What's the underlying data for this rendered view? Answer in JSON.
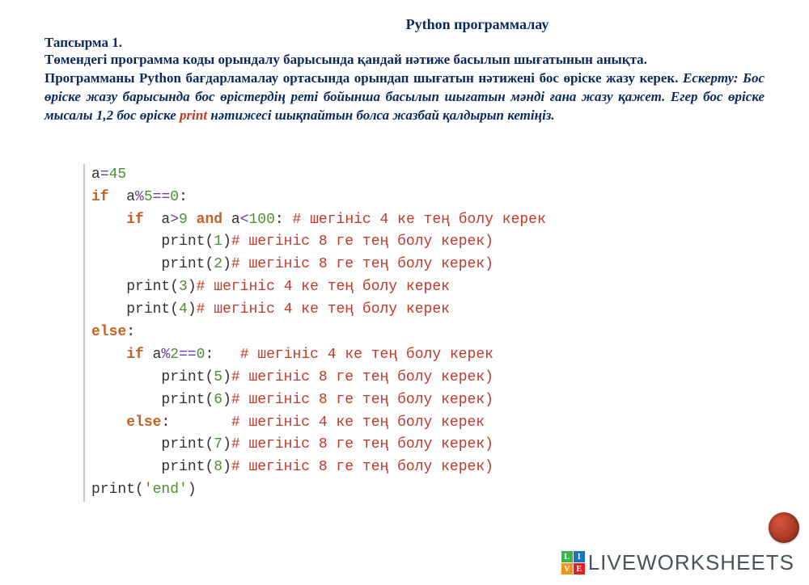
{
  "title": "Python программалау",
  "task_label": "Тапсырма 1.",
  "para1": "Төмендегі программа коды орындалу барысында қандай нәтиже басылып шығатынын анықта.",
  "para2a": "Программаны Python бағдарламалау ортасында орындап шығатын нәтижені бос өріске жазу керек. ",
  "note1": "Ескерту: Бос өріске жазу барысында бос өрістердің реті бойынша басылып шығатын мәнді ғана жазу қажет. Егер бос өріске мысалы 1,2 бос өріске ",
  "note_print": "print",
  "note2": " нәтижесі шықпайтын болса жазбай қалдырып кетіңіз.",
  "code": {
    "l1_a": "a",
    "l1_eq": "=",
    "l1_v": "45",
    "l2_if": "if",
    "l2_expr1": "  a",
    "l2_op": "%",
    "l2_v5": "5",
    "l2_eqeq": "==",
    "l2_v0": "0",
    "l2_colon": ":",
    "l3_if": "if",
    "l3_a": "  a",
    "l3_gt": ">",
    "l3_9": "9",
    "l3_and": "and",
    "l3_a2": " a",
    "l3_lt": "<",
    "l3_100": "100",
    "l3_colon": ":",
    "l3_cmt": " # шегініс 4 ке тең болу керек",
    "l4_fn": "print",
    "l4_p": "(",
    "l4_n": "1",
    "l4_q": ")",
    "l4_cmt": "# шегініс 8 ге тең болу керек)",
    "l5_fn": "print",
    "l5_n": "2",
    "l5_cmt": "# шегініс 8 ге тең болу керек)",
    "l6_fn": "print",
    "l6_n": "3",
    "l6_cmt": "# шегініс 4 ке тең болу керек",
    "l7_fn": "print",
    "l7_n": "4",
    "l7_cmt": "# шегініс 4 ке тең болу керек",
    "l8_else": "else",
    "l8_colon": ":",
    "l9_if": "if",
    "l9_a": " a",
    "l9_op": "%",
    "l9_2": "2",
    "l9_eqeq": "==",
    "l9_0": "0",
    "l9_colon": ":",
    "l9_cmt": "   # шегініс 4 ке тең болу керек",
    "l10_fn": "print",
    "l10_n": "5",
    "l10_cmt": "# шегініс 8 ге тең болу керек)",
    "l11_fn": "print",
    "l11_n": "6",
    "l11_cmt": "# шегініс 8 ге тең болу керек)",
    "l12_else": "else",
    "l12_colon": ":",
    "l12_cmt": "       # шегініс 4 ке тең болу керек",
    "l13_fn": "print",
    "l13_n": "7",
    "l13_cmt": "# шегініс 8 ге тең болу керек)",
    "l14_fn": "print",
    "l14_n": "8",
    "l14_cmt": "# шегініс 8 ге тең болу керек)",
    "l15_fn": "print",
    "l15_p": "(",
    "l15_s": "'end'",
    "l15_q": ")"
  },
  "logo": {
    "s1": "L",
    "s2": "I",
    "s3": "V",
    "s4": "E",
    "text": "LIVEWORKSHEETS"
  }
}
